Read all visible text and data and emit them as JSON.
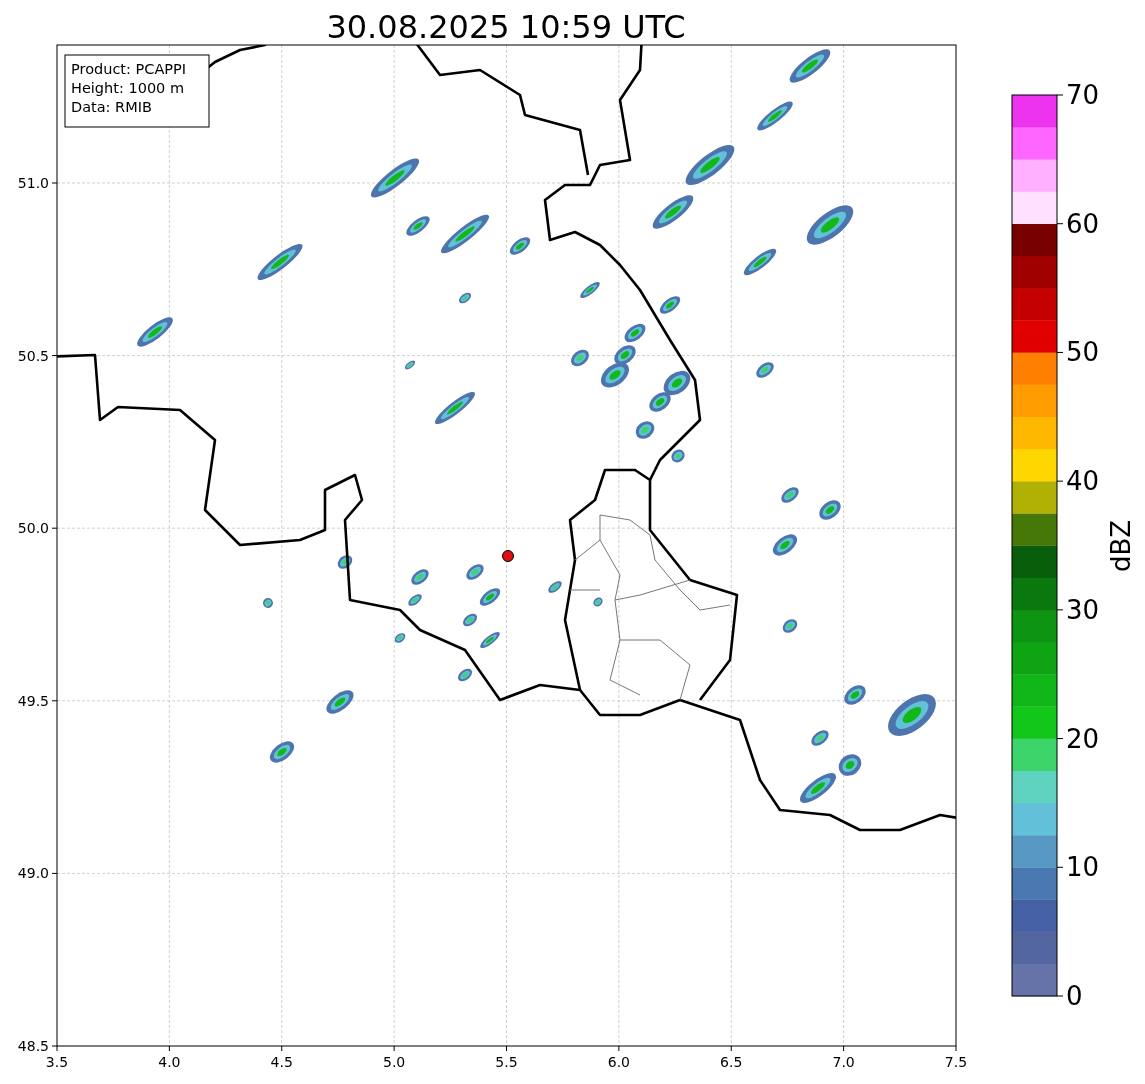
{
  "title": "30.08.2025 10:59 UTC",
  "info_box": [
    "Product: PCAPPI",
    "Height: 1000 m",
    "Data: RMIB"
  ],
  "x_axis": {
    "ticks": [
      "3.5",
      "4.0",
      "4.5",
      "5.0",
      "5.5",
      "6.0",
      "6.5",
      "7.0",
      "7.5"
    ]
  },
  "y_axis": {
    "ticks": [
      "51.0",
      "50.5",
      "50.0",
      "49.5",
      "49.0",
      "48.5"
    ]
  },
  "colorbar": {
    "label": "dBZ",
    "ticks": [
      "70",
      "60",
      "50",
      "40",
      "30",
      "20",
      "10",
      "0"
    ],
    "bands": [
      {
        "color": "#6673a8"
      },
      {
        "color": "#5366a0"
      },
      {
        "color": "#4560a5"
      },
      {
        "color": "#4a78b0"
      },
      {
        "color": "#5899c4"
      },
      {
        "color": "#62c0d8"
      },
      {
        "color": "#5fd3c0"
      },
      {
        "color": "#3dd46c"
      },
      {
        "color": "#12c71a"
      },
      {
        "color": "#10b618"
      },
      {
        "color": "#0fa414"
      },
      {
        "color": "#0d9412"
      },
      {
        "color": "#0a780e"
      },
      {
        "color": "#085e0a"
      },
      {
        "color": "#467808"
      },
      {
        "color": "#b0b005"
      },
      {
        "color": "#ffd700"
      },
      {
        "color": "#ffb800"
      },
      {
        "color": "#ff9c00"
      },
      {
        "color": "#ff8000"
      },
      {
        "color": "#e00000"
      },
      {
        "color": "#c40000"
      },
      {
        "color": "#a00000"
      },
      {
        "color": "#780000"
      },
      {
        "color": "#ffe0ff"
      },
      {
        "color": "#ffb0ff"
      },
      {
        "color": "#ff66ff"
      },
      {
        "color": "#ee33ee"
      }
    ]
  }
}
